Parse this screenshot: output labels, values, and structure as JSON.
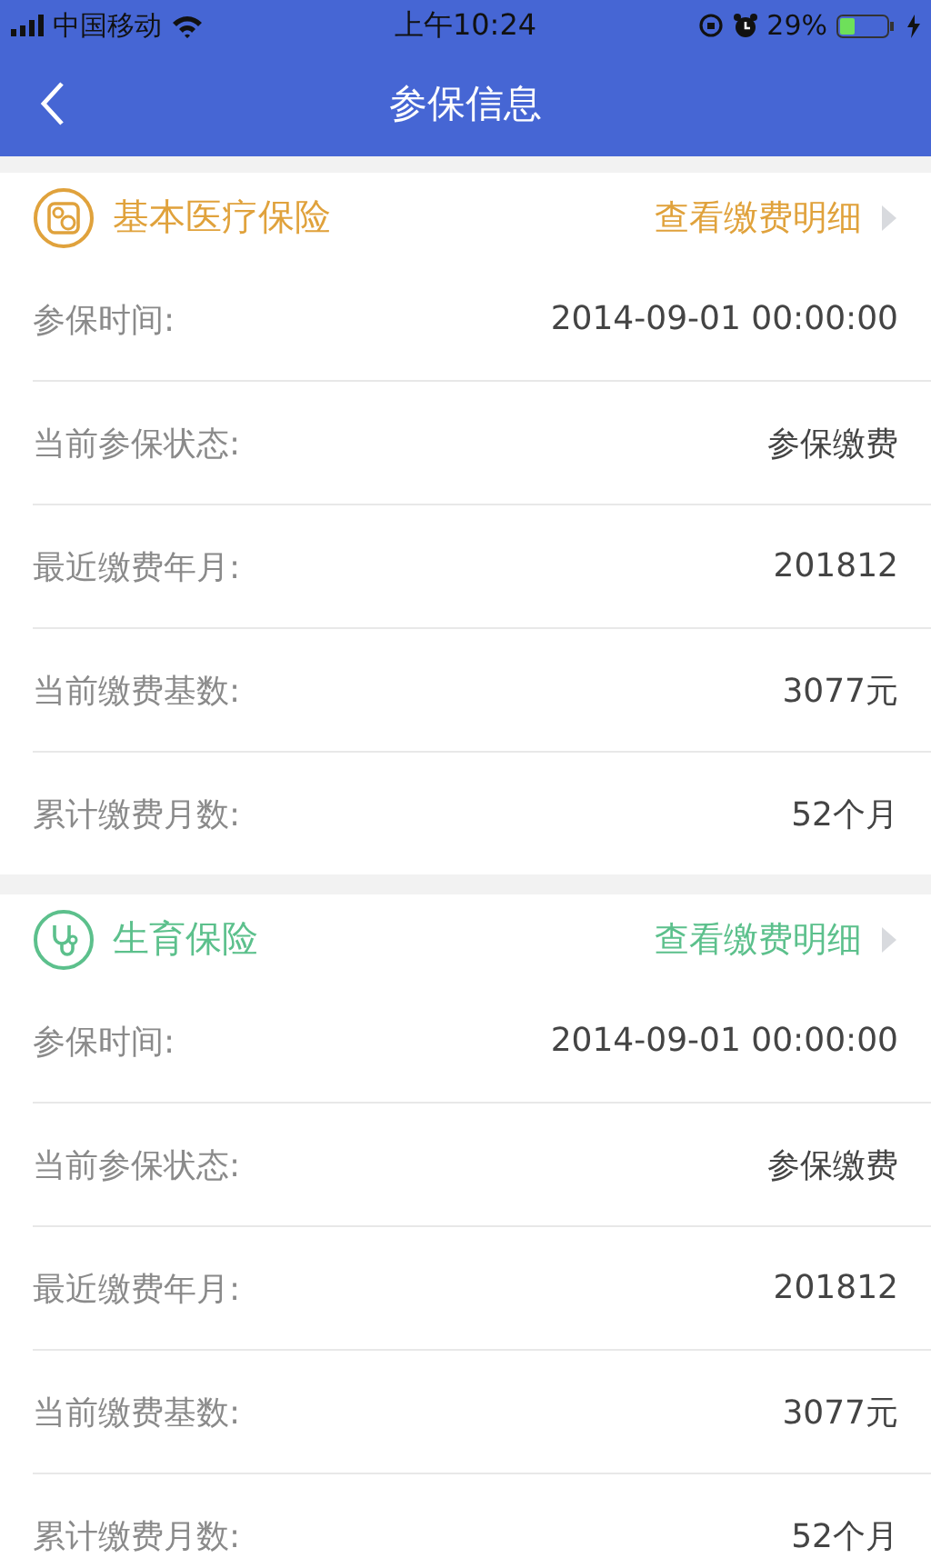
{
  "status_bar": {
    "carrier": "中国移动",
    "time": "上午10:24",
    "battery": "29%"
  },
  "nav": {
    "title": "参保信息"
  },
  "sections": [
    {
      "kind": "medical",
      "title": "基本医疗保险",
      "color": "#e0a23c",
      "link": "查看缴费明细",
      "rows": [
        {
          "label": "参保时间:",
          "value": "2014-09-01 00:00:00"
        },
        {
          "label": "当前参保状态:",
          "value": "参保缴费"
        },
        {
          "label": "最近缴费年月:",
          "value": "201812"
        },
        {
          "label": "当前缴费基数:",
          "value": "3077元"
        },
        {
          "label": "累计缴费月数:",
          "value": "52个月"
        }
      ]
    },
    {
      "kind": "maternity",
      "title": "生育保险",
      "color": "#5cc08c",
      "link": "查看缴费明细",
      "rows": [
        {
          "label": "参保时间:",
          "value": "2014-09-01 00:00:00"
        },
        {
          "label": "当前参保状态:",
          "value": "参保缴费"
        },
        {
          "label": "最近缴费年月:",
          "value": "201812"
        },
        {
          "label": "当前缴费基数:",
          "value": "3077元"
        },
        {
          "label": "累计缴费月数:",
          "value": "52个月"
        }
      ]
    }
  ]
}
